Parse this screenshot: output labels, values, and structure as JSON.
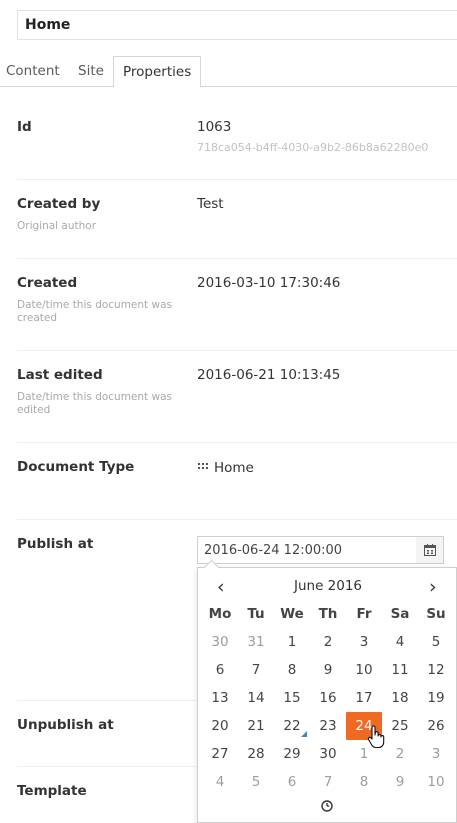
{
  "header": {
    "name_value": "Home"
  },
  "tabs": [
    {
      "label": "Content"
    },
    {
      "label": "Site"
    },
    {
      "label": "Properties"
    }
  ],
  "properties": {
    "id": {
      "label": "Id",
      "value": "1063",
      "guid": "718ca054-b4ff-4030-a9b2-86b8a62280e0"
    },
    "created_by": {
      "label": "Created by",
      "description": "Original author",
      "value": "Test"
    },
    "created": {
      "label": "Created",
      "description": "Date/time this document was created",
      "value": "2016-03-10 17:30:46"
    },
    "last_edited": {
      "label": "Last edited",
      "description": "Date/time this document was edited",
      "value": "2016-06-21 10:13:45"
    },
    "document_type": {
      "label": "Document Type",
      "value": "Home",
      "icon": "grid-dots-icon"
    },
    "publish_at": {
      "label": "Publish at",
      "value": "2016-06-24 12:00:00"
    },
    "unpublish_at": {
      "label": "Unpublish at"
    },
    "template": {
      "label": "Template"
    }
  },
  "datepicker": {
    "month_label": "June 2016",
    "prev": "‹",
    "next": "›",
    "weekdays": [
      "Mo",
      "Tu",
      "We",
      "Th",
      "Fr",
      "Sa",
      "Su"
    ],
    "weeks": [
      [
        "30",
        "31",
        "1",
        "2",
        "3",
        "4",
        "5"
      ],
      [
        "6",
        "7",
        "8",
        "9",
        "10",
        "11",
        "12"
      ],
      [
        "13",
        "14",
        "15",
        "16",
        "17",
        "18",
        "19"
      ],
      [
        "20",
        "21",
        "22",
        "23",
        "24",
        "25",
        "26"
      ],
      [
        "27",
        "28",
        "29",
        "30",
        "1",
        "2",
        "3"
      ],
      [
        "4",
        "5",
        "6",
        "7",
        "8",
        "9",
        "10"
      ]
    ],
    "selected_day": "24",
    "today_day": "22",
    "colors": {
      "selected_bg": "#ef6a22",
      "today_marker": "#3d88c9"
    }
  }
}
